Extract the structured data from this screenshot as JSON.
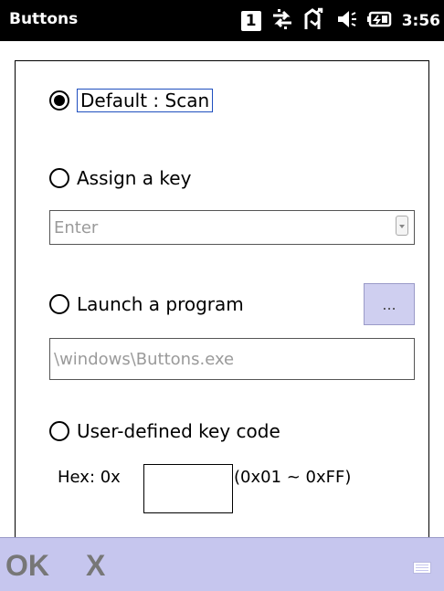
{
  "title_bar": {
    "title": "Buttons",
    "notification_badge": "1",
    "icons": [
      "notification-icon",
      "data-sync-icon",
      "missed-call-icon",
      "speaker-icon",
      "battery-icon"
    ],
    "clock": "3:56"
  },
  "options": {
    "default_scan": {
      "label": "Default : Scan",
      "selected": true
    },
    "assign_key": {
      "label": "Assign a key",
      "selected": false,
      "dropdown_value": "Enter"
    },
    "launch_program": {
      "label": "Launch a program",
      "selected": false,
      "browse_label": "...",
      "path_value": "\\windows\\Buttons.exe"
    },
    "user_defined": {
      "label": "User-defined key code",
      "selected": false,
      "hex_prefix": "Hex: 0x",
      "hex_value": "",
      "hex_range": "(0x01 ~ 0xFF)"
    }
  },
  "softkeys": {
    "ok": "OK",
    "cancel": "X"
  },
  "colors": {
    "title_bg": "#000000",
    "softkey_bg": "#c6c6ee",
    "browse_bg": "#cfcff0"
  }
}
